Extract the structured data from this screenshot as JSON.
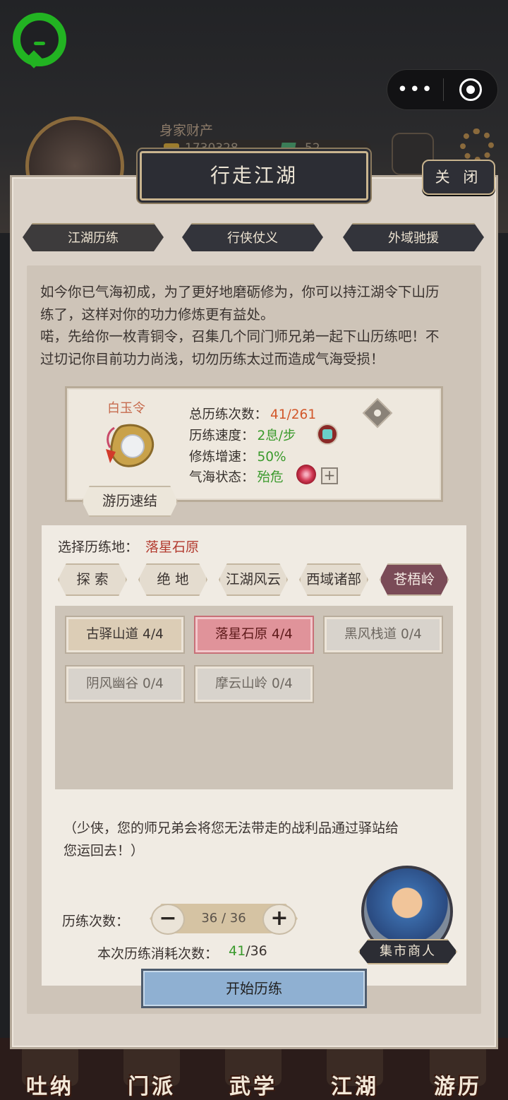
{
  "header": {
    "wealth_label": "身家财产",
    "coins": "1730328",
    "tickets": "52"
  },
  "dialog": {
    "title": "行走江湖",
    "close_label": "关 闭",
    "tabs": [
      {
        "label": "江湖历练",
        "active": true
      },
      {
        "label": "行侠仗义",
        "active": false
      },
      {
        "label": "外域驰援",
        "active": false
      }
    ],
    "intro": [
      "如今你已气海初成，为了更好地磨砺修为，你可以持江湖令下山历",
      "练了，这样对你的功力修炼更有益处。",
      "喏，先给你一枚青铜令，召集几个同门师兄弟一起下山历练吧！不",
      "过切记你目前功力尚浅，切勿历练太过而造成气海受损！"
    ],
    "token": {
      "name": "白玉令",
      "stats": [
        {
          "label": "总历练次数：",
          "value": "41/261",
          "color": "#d2572a"
        },
        {
          "label": "历练速度：",
          "value": "2息/步",
          "color": "#3a9a2c"
        },
        {
          "label": "修炼增速：",
          "value": "50%",
          "color": "#3a9a2c"
        },
        {
          "label": "气海状态：",
          "value": "殆危",
          "color": "#3a9a2c"
        }
      ],
      "quick_label": "游历速结"
    },
    "select": {
      "label": "选择历练地：",
      "value": "落星石原",
      "regions": [
        {
          "label": "探 索",
          "active": false
        },
        {
          "label": "绝 地",
          "active": false
        },
        {
          "label": "江湖风云",
          "active": false
        },
        {
          "label": "西域诸部",
          "active": false
        },
        {
          "label": "苍梧岭",
          "active": true
        }
      ],
      "locations": [
        {
          "label": "古驿山道 4/4",
          "state": "avail"
        },
        {
          "label": "落星石原 4/4",
          "state": "selected"
        },
        {
          "label": "黑风栈道 0/4",
          "state": "locked"
        },
        {
          "label": "阴风幽谷 0/4",
          "state": "locked"
        },
        {
          "label": "摩云山岭 0/4",
          "state": "locked"
        }
      ]
    },
    "note": [
      "（少侠，您的师兄弟会将您无法带走的战利品通过驿站给",
      "您运回去！）"
    ],
    "count": {
      "label": "历练次数：",
      "minus": "−",
      "plus": "+",
      "value": "36 / 36",
      "cost_label": "本次历练消耗次数：",
      "cost_used": "41",
      "cost_total": "/36"
    },
    "merchant_label": "集市商人",
    "start_label": "开始历练"
  },
  "bottom_nav": [
    "吐纳",
    "门派",
    "武学",
    "江湖",
    "游历"
  ]
}
